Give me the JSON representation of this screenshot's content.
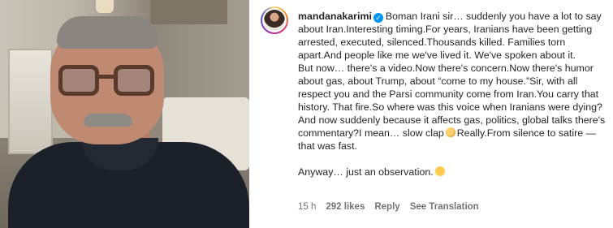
{
  "comment": {
    "username": "mandanakarimi",
    "text_1": "Boman Irani sir… suddenly you have a lot to say about Iran.Interesting timing.For years, Iranians have been getting arrested, executed, silenced.Thousands killed. Families torn apart.And people like me we've lived it. We've spoken about it.",
    "text_2a": "But now… there's a video.Now there's concern.Now there's humor about gas, about Trump, about “come to my house.”Sir, with all respect you and the Parsi community come from Iran.You carry that history. That fire.So where was this voice when Iranians were dying?And now suddenly because it affects gas, politics, global talks there's commentary?I mean… slow clap",
    "text_2b": "Really.From silence to satire — that was fast.",
    "text_3": "Anyway… just an observation.",
    "time": "15 h",
    "likes": "292 likes",
    "reply": "Reply",
    "see_translation": "See Translation",
    "icons": {
      "verified": "verified-badge-icon",
      "clap": "clapping-hands-emoji",
      "smile": "smiling-face-emoji"
    },
    "colors": {
      "verified": "#0095f6",
      "meta_text": "#737373",
      "text": "#262626"
    }
  }
}
